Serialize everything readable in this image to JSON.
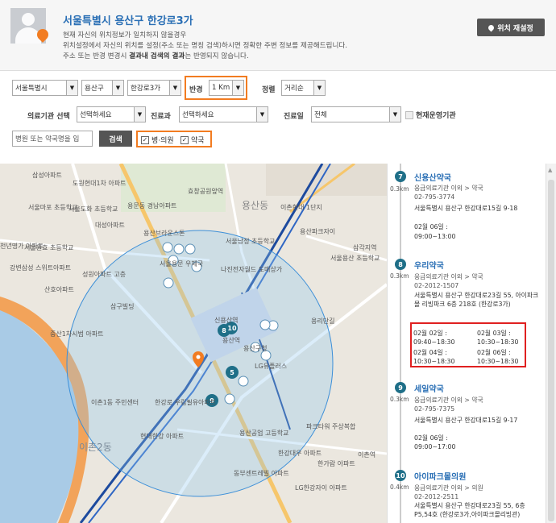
{
  "header": {
    "location": "서울특별시 용산구 한강로3가",
    "notice_line1": "현재 자신의 위치정보가 일치하지 않을경우",
    "notice_line2": "위치설정에서 자신의 위치를 설정(주소 또는 명칭 검색)하시면 정확한 주변 정보를 제공해드립니다.",
    "notice_line3_pre": "주소 또는 반경 변경시 ",
    "notice_line3_bold": "결과내 검색의 결과",
    "notice_line3_post": "는 반영되지 않습니다.",
    "relocate_label": "위치 재설정"
  },
  "filters": {
    "city": "서울특별시",
    "district": "용산구",
    "dong": "한강로3가",
    "radius_label": "반경",
    "radius_value": "1 Km",
    "sort_label": "정렬",
    "sort_value": "거리순",
    "type_label": "의료기관 선택",
    "type_value": "선택하세요",
    "dept_label": "진료과",
    "dept_value": "선택하세요",
    "day_label": "진료일",
    "day_value": "전체",
    "operating_label": "현재운영기관",
    "search_placeholder": "병원 또는 약국명을 입",
    "search_button": "검색",
    "hospital_label": "병·의원",
    "pharmacy_label": "약국"
  },
  "map": {
    "labels": [
      "삼성아파트",
      "도원현대1차 아파트",
      "서울마포 초등학교",
      "서울도화 초등학교",
      "대성아파트",
      "효창공원앞역",
      "용문동 경남아파트",
      "이촌현대 1단지",
      "서울원효 초등학교",
      "용산브라운스톤",
      "서울남정 초등학교",
      "삼각지역",
      "서울용산 초등학교",
      "천년명가 아파트",
      "강변삼성 스위트아파트",
      "성원아파트 고층",
      "산호아파트",
      "삼구빌딩",
      "용산파크자이",
      "서울용문 우체국",
      "나진전자월드 도매상가",
      "중산1차시범 아파트",
      "용산역",
      "LG유플러스",
      "용리단길",
      "이촌1동 주민센터",
      "한강로 우림필유아파트",
      "현대한강 아파트",
      "용산공업 고등학교",
      "파크타워 주상복합",
      "한강대우 아파트",
      "이촌역",
      "한가람 아파트",
      "동부센트레빌 아파트",
      "LG한강자이 아파트",
      "신용산역",
      "이촌2동",
      "용산구청",
      "용산동"
    ]
  },
  "results": [
    {
      "num": "7",
      "distance": "0.3km",
      "name": "신용산약국",
      "category": "응급의료기관 이외 > 약국",
      "phone": "02-795-3774",
      "address": "서울특별시 용산구 한강대로15길 9-18",
      "hours": [
        "02월 06일 :",
        "09:00~13:00"
      ]
    },
    {
      "num": "8",
      "distance": "0.3km",
      "name": "우리약국",
      "category": "응급의료기관 이외 > 약국",
      "phone": "02-2012-1507",
      "address": "서울특별시 용산구 한강대로23길 55, 아이파크몰 리빙파크 6층 218호 (한강로3가)",
      "hours": [
        "02월 02일 :",
        "02월 03일 :",
        "09:40~18:30",
        "10:30~18:30",
        "02월 04일 :",
        "02월 06일 :",
        "10:30~18:30",
        "10:30~18:30"
      ]
    },
    {
      "num": "9",
      "distance": "0.3km",
      "name": "세일약국",
      "category": "응급의료기관 이외 > 약국",
      "phone": "02-795-7375",
      "address": "서울특별시 용산구 한강대로15길 9-17",
      "hours": [
        "02월 06일 :",
        "09:00~17:00"
      ]
    },
    {
      "num": "10",
      "distance": "0.4km",
      "name": "아이파크몰의원",
      "category": "응급의료기관 이외 > 의원",
      "phone": "02-2012-2511",
      "address": "서울특별시 용산구 한강대로23길 55, 6층 P5,54호 (한강로3가,아이파크몰리빙관)"
    }
  ],
  "colors": {
    "accent_blue": "#2a6fb5",
    "highlight_orange": "#f27c21",
    "highlight_red": "#e02020",
    "marker_teal": "#1f6f88"
  }
}
